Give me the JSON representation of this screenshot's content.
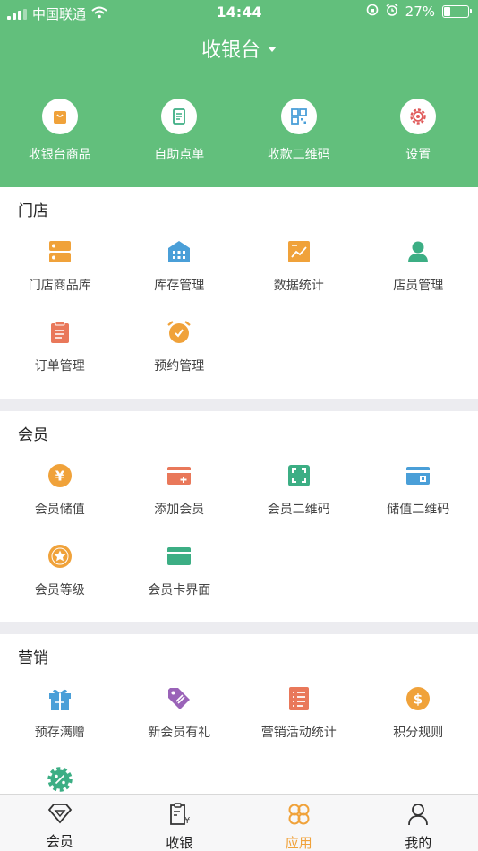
{
  "status_bar": {
    "carrier": "中国联通",
    "time": "14:44",
    "battery": "27%",
    "battery_level": 0.27
  },
  "header": {
    "title": "收银台",
    "quick_actions": [
      {
        "label": "收银台商品",
        "icon": "shopping-bag-icon"
      },
      {
        "label": "自助点单",
        "icon": "order-list-icon"
      },
      {
        "label": "收款二维码",
        "icon": "qr-code-icon"
      },
      {
        "label": "设置",
        "icon": "gear-icon"
      }
    ]
  },
  "sections": [
    {
      "title": "门店",
      "items": [
        {
          "label": "门店商品库",
          "icon": "server-icon",
          "color": "#f0a23a"
        },
        {
          "label": "库存管理",
          "icon": "warehouse-icon",
          "color": "#4a9fd8"
        },
        {
          "label": "数据统计",
          "icon": "chart-icon",
          "color": "#f0a23a"
        },
        {
          "label": "店员管理",
          "icon": "user-icon",
          "color": "#3cae84"
        },
        {
          "label": "订单管理",
          "icon": "clipboard-icon",
          "color": "#e9785a"
        },
        {
          "label": "预约管理",
          "icon": "alarm-clock-icon",
          "color": "#f0a23a"
        }
      ]
    },
    {
      "title": "会员",
      "items": [
        {
          "label": "会员储值",
          "icon": "yen-coin-icon",
          "color": "#f0a23a"
        },
        {
          "label": "添加会员",
          "icon": "add-card-icon",
          "color": "#e9785a"
        },
        {
          "label": "会员二维码",
          "icon": "scan-icon",
          "color": "#3cae84"
        },
        {
          "label": "储值二维码",
          "icon": "qr-card-icon",
          "color": "#4a9fd8"
        },
        {
          "label": "会员等级",
          "icon": "star-badge-icon",
          "color": "#f0a23a"
        },
        {
          "label": "会员卡界面",
          "icon": "card-icon",
          "color": "#3cae84"
        }
      ]
    },
    {
      "title": "营销",
      "items": [
        {
          "label": "预存满赠",
          "icon": "gift-icon",
          "color": "#4a9fd8"
        },
        {
          "label": "新会员有礼",
          "icon": "tag-icon",
          "color": "#9a63b8"
        },
        {
          "label": "营销活动统计",
          "icon": "list-doc-icon",
          "color": "#e9785a"
        },
        {
          "label": "积分规则",
          "icon": "dollar-coin-icon",
          "color": "#f0a23a"
        },
        {
          "label": "",
          "icon": "discount-gear-icon",
          "color": "#3cae84"
        }
      ]
    }
  ],
  "tabbar": [
    {
      "label": "会员",
      "icon": "diamond-icon",
      "active": false
    },
    {
      "label": "收银",
      "icon": "receipt-icon",
      "active": false
    },
    {
      "label": "应用",
      "icon": "clover-icon",
      "active": true
    },
    {
      "label": "我的",
      "icon": "person-icon",
      "active": false
    }
  ],
  "colors": {
    "brand_green": "#62bf7c",
    "accent_orange": "#f0a23a"
  }
}
